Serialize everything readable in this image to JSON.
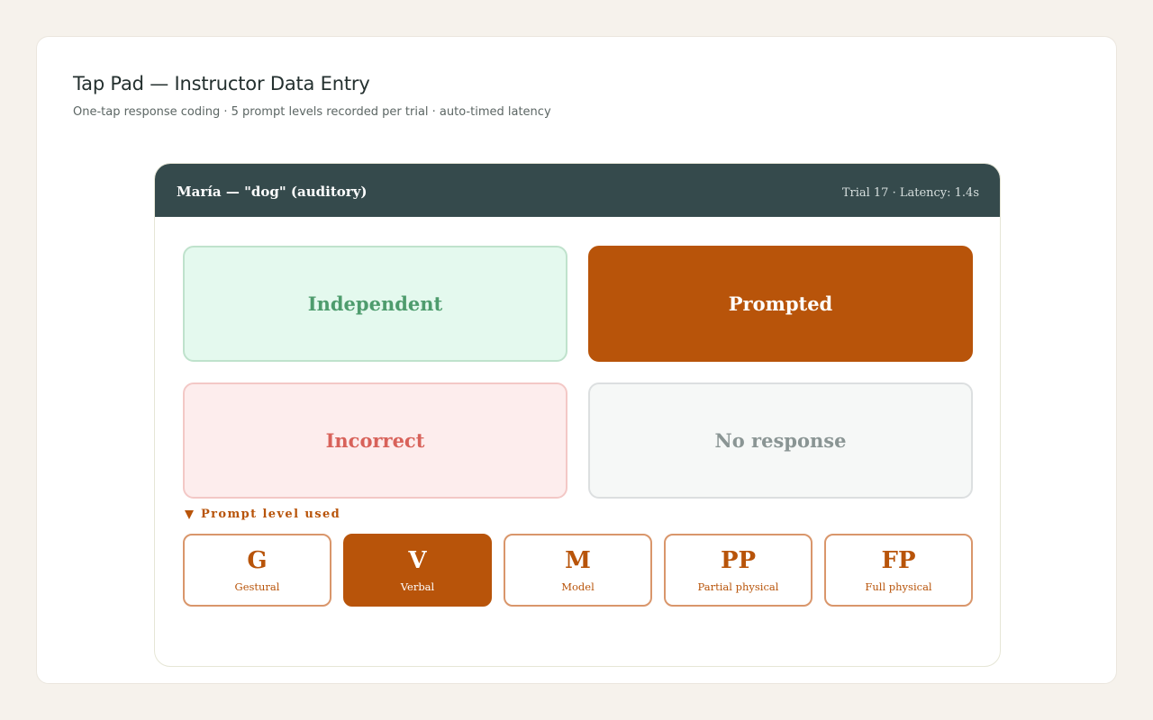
{
  "header": {
    "title": "Tap Pad — Instructor Data Entry",
    "subtitle": "One-tap response coding · 5 prompt levels recorded per trial · auto-timed latency"
  },
  "pad": {
    "learner_target": "María — \"dog\" (auditory)",
    "trial_info": "Trial 17 · Latency: 1.4s",
    "responses": {
      "independent": "Independent",
      "prompted": "Prompted",
      "incorrect": "Incorrect",
      "no_response": "No response"
    },
    "selected_response": "Prompted",
    "prompt_section_label": "Prompt level used",
    "prompt_levels": [
      {
        "code": "G",
        "name": "Gestural"
      },
      {
        "code": "V",
        "name": "Verbal"
      },
      {
        "code": "M",
        "name": "Model"
      },
      {
        "code": "PP",
        "name": "Partial physical"
      },
      {
        "code": "FP",
        "name": "Full physical"
      }
    ],
    "selected_prompt_level": "V"
  },
  "colors": {
    "accent": "#b8540a",
    "header_bg": "#354a4c",
    "independent": "#4e9c6d",
    "incorrect": "#d8625a",
    "no_response": "#8a9594"
  }
}
